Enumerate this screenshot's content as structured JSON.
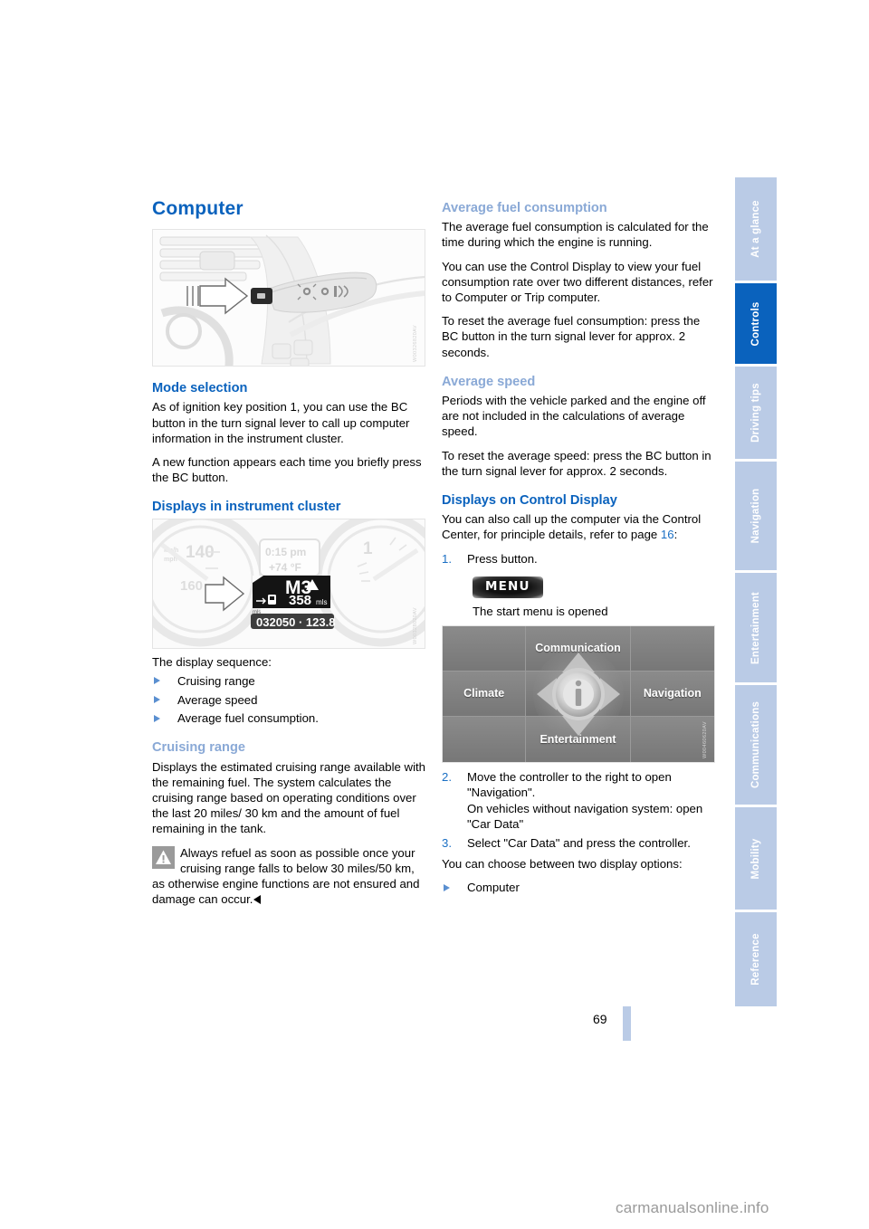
{
  "document": {
    "page_number": "69",
    "watermark": "carmanualsonline.info"
  },
  "sidebar": {
    "tabs": [
      {
        "label": "At a glance",
        "active": false
      },
      {
        "label": "Controls",
        "active": true
      },
      {
        "label": "Driving tips",
        "active": false
      },
      {
        "label": "Navigation",
        "active": false
      },
      {
        "label": "Entertainment",
        "active": false
      },
      {
        "label": "Communications",
        "active": false
      },
      {
        "label": "Mobility",
        "active": false
      },
      {
        "label": "Reference",
        "active": false
      }
    ]
  },
  "left_column": {
    "title": "Computer",
    "figure_lever": {
      "caption_code": "W00326820AV",
      "alt": "Turn signal lever with BC button, arrow pointing to button"
    },
    "mode_selection": {
      "heading": "Mode selection",
      "paragraphs": [
        "As of ignition key position 1, you can use the BC button in the turn signal lever to call up computer information in the instrument cluster.",
        "A new function appears each time you briefly press the BC button."
      ]
    },
    "displays_instrument_cluster": {
      "heading": "Displays in instrument cluster",
      "figure": {
        "caption_code": "W00328020AV",
        "gear": "M3",
        "range": "358",
        "range_unit": "mls",
        "clock": "0:15 pm",
        "temperature": "+74",
        "temperature_unit": "F",
        "odometer": "032050",
        "trip": "123.8",
        "consumption_unit": "mls",
        "speed_ticks": [
          "140",
          "160"
        ],
        "tach_tick": "1"
      },
      "sequence_intro": "The display sequence:",
      "sequence": [
        "Cruising range",
        "Average speed",
        "Average fuel consumption."
      ]
    },
    "cruising_range": {
      "heading": "Cruising range",
      "paragraph": "Displays the estimated cruising range available with the remaining fuel. The system calculates the cruising range based on operating conditions over the last 20 miles/ 30 km and the amount of fuel remaining in the tank.",
      "warning": "Always refuel as soon as possible once your cruising range falls to below 30 miles/50 km, as otherwise engine functions are not ensured and damage can occur."
    }
  },
  "right_column": {
    "average_fuel_consumption": {
      "heading": "Average fuel consumption",
      "paragraphs": [
        "The average fuel consumption is calculated for the time during which the engine is running.",
        "You can use the Control Display to view your fuel consumption rate over two different distances, refer to Computer or Trip computer.",
        "To reset the average fuel consumption: press the BC button in the turn signal lever for approx. 2 seconds."
      ]
    },
    "average_speed": {
      "heading": "Average speed",
      "paragraphs": [
        "Periods with the vehicle parked and the engine off are not included in the calculations of average speed.",
        "To reset the average speed: press the BC button in the turn signal lever for approx. 2 seconds."
      ]
    },
    "displays_control_display": {
      "heading": "Displays on Control Display",
      "intro_prefix": "You can also call up the computer via the Control Center, for principle details, refer to page ",
      "intro_page_ref": "16",
      "intro_suffix": ":",
      "step1_number": "1.",
      "step1_text": "Press button.",
      "menu_key_label": "MENU",
      "menu_key_caption": "The start menu is opened",
      "figure_menu": {
        "caption_code": "W00460620AV",
        "top": "Communication",
        "left": "Climate",
        "right": "Navigation",
        "bottom": "Entertainment",
        "center_icon": "info-icon"
      },
      "steps": [
        {
          "number": "2.",
          "text": "Move the controller to the right to open \"Navigation\".\nOn vehicles without navigation system: open \"Car Data\""
        },
        {
          "number": "3.",
          "text": "Select \"Car Data\" and press the controller."
        }
      ],
      "options_intro": "You can choose between two display options:",
      "options": [
        "Computer"
      ]
    }
  }
}
